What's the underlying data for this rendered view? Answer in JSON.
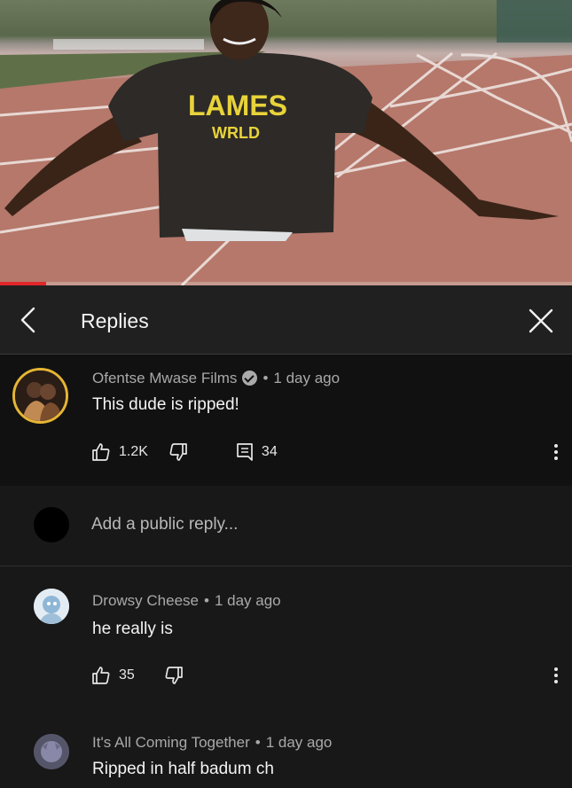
{
  "video": {
    "shirt_text_line1": "LAMES",
    "shirt_text_line2": "WRLD",
    "progress_fraction": 0.08,
    "progress_color": "#e0262a"
  },
  "header": {
    "back_icon": "chevron-left-icon",
    "title": "Replies",
    "close_icon": "close-icon"
  },
  "top_comment": {
    "author": "Ofentse Mwase Films",
    "verified": true,
    "separator": "•",
    "time": "1 day ago",
    "text": "This dude is ripped!",
    "likes": "1.2K",
    "reply_count": "34",
    "icons": [
      "thumbs-up-icon",
      "thumbs-down-icon",
      "reply-icon",
      "more-vertical-icon"
    ]
  },
  "reply_box": {
    "placeholder": "Add a public reply..."
  },
  "replies": [
    {
      "author": "Drowsy Cheese",
      "separator": "•",
      "time": "1 day ago",
      "text": "he really is",
      "likes": "35"
    },
    {
      "author": "It's All Coming Together",
      "separator": "•",
      "time": "1 day ago",
      "text": "Ripped in half badum ch"
    }
  ],
  "colors": {
    "background": "#181818",
    "highlight_comment": "#111111",
    "header_bg": "#202020",
    "secondary_text": "#a9a9a9",
    "avatar_ring": "#e5b534"
  }
}
